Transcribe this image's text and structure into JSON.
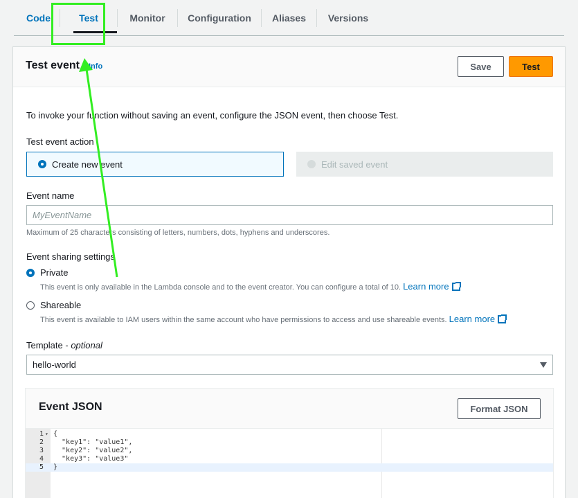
{
  "tabs": [
    {
      "label": "Code"
    },
    {
      "label": "Test"
    },
    {
      "label": "Monitor"
    },
    {
      "label": "Configuration"
    },
    {
      "label": "Aliases"
    },
    {
      "label": "Versions"
    }
  ],
  "panel": {
    "title": "Test event",
    "info_link": "Info",
    "save_label": "Save",
    "test_label": "Test",
    "description": "To invoke your function without saving an event, configure the JSON event, then choose Test."
  },
  "test_event_action": {
    "label": "Test event action",
    "create_label": "Create new event",
    "edit_label": "Edit saved event",
    "selected": "Create new event"
  },
  "event_name": {
    "label": "Event name",
    "placeholder": "MyEventName",
    "value": "",
    "hint": "Maximum of 25 characters consisting of letters, numbers, dots, hyphens and underscores."
  },
  "sharing": {
    "label": "Event sharing settings",
    "selected": "Private",
    "private_label": "Private",
    "private_desc": "This event is only available in the Lambda console and to the event creator. You can configure a total of 10.",
    "shareable_label": "Shareable",
    "shareable_desc": "This event is available to IAM users within the same account who have permissions to access and use shareable events.",
    "learn_more": "Learn more"
  },
  "template": {
    "label": "Template - ",
    "label_optional": "optional",
    "value": "hello-world"
  },
  "event_json": {
    "title": "Event JSON",
    "format_label": "Format JSON",
    "lines": [
      {
        "num": "1",
        "text": "{"
      },
      {
        "num": "2",
        "text": "  \"key1\": \"value1\","
      },
      {
        "num": "3",
        "text": "  \"key2\": \"value2\","
      },
      {
        "num": "4",
        "text": "  \"key3\": \"value3\""
      },
      {
        "num": "5",
        "text": "}"
      }
    ]
  },
  "colors": {
    "accent": "#0073bb",
    "primary_button": "#ff9900",
    "annotation": "#33ee22"
  }
}
